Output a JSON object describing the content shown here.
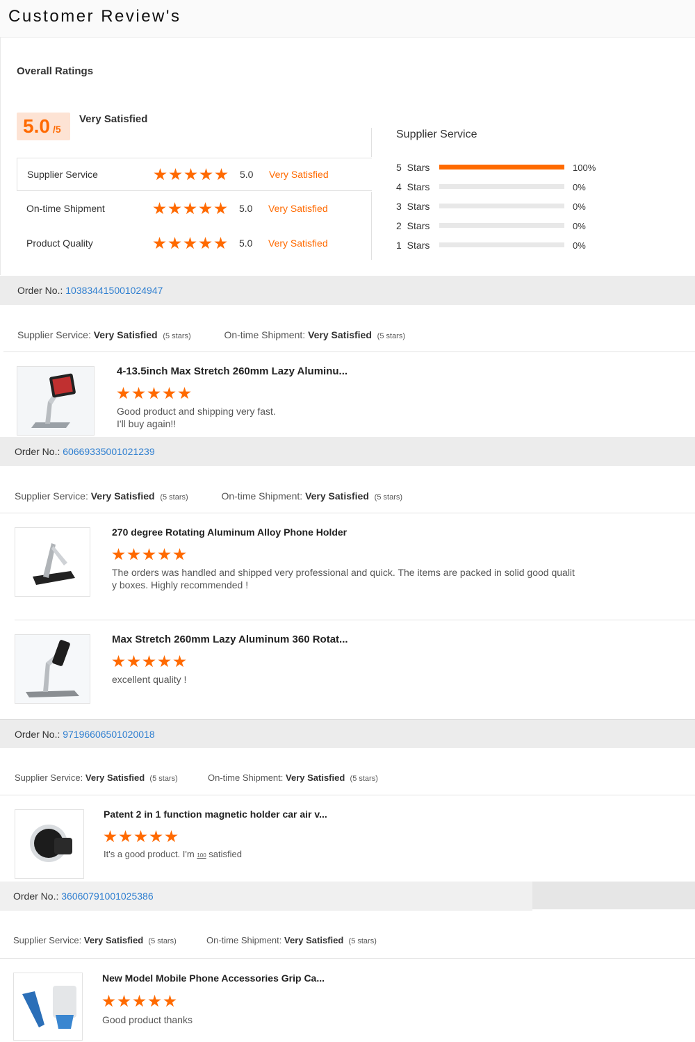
{
  "page": {
    "title": "Customer Review's"
  },
  "overall": {
    "heading": "Overall Ratings",
    "score": "5.0",
    "score_max": "/5",
    "score_text": "Very Satisfied",
    "ratings": [
      {
        "label": "Supplier Service",
        "stars": 5,
        "value": "5.0",
        "text": "Very Satisfied"
      },
      {
        "label": "On-time Shipment",
        "stars": 5,
        "value": "5.0",
        "text": "Very Satisfied"
      },
      {
        "label": "Product Quality",
        "stars": 5,
        "value": "5.0",
        "text": "Very Satisfied"
      }
    ]
  },
  "distribution": {
    "title": "Supplier Service",
    "rows": [
      {
        "label": "5 Stars",
        "fraction": 1.0,
        "pct": "100%"
      },
      {
        "label": "4 Stars",
        "fraction": 0,
        "pct": "0%"
      },
      {
        "label": "3 Stars",
        "fraction": 0,
        "pct": "0%"
      },
      {
        "label": "2 Stars",
        "fraction": 0,
        "pct": "0%"
      },
      {
        "label": "1 Stars",
        "fraction": 0,
        "pct": "0%"
      }
    ]
  },
  "labels": {
    "order_no": "Order No.:",
    "supplier_service": "Supplier Service:",
    "ontime_shipment": "On-time Shipment:",
    "very_satisfied": "Very Satisfied",
    "five_stars": "(5 stars)"
  },
  "orders": [
    {
      "number": "103834415001024947",
      "products": [
        {
          "title": "4-13.5inch Max Stretch 260mm Lazy Aluminu...",
          "stars": 5,
          "comment_lines": [
            "Good product and shipping very fast.",
            "I'll buy again!!"
          ]
        }
      ]
    },
    {
      "number": "60669335001021239",
      "products": [
        {
          "title": "270 degree Rotating Aluminum Alloy Phone Holder",
          "stars": 5,
          "comment_lines": [
            "The orders was handled and shipped very professional and quick. The items are packed in solid good qualit",
            "y boxes. Highly recommended !"
          ]
        },
        {
          "title": "Max Stretch 260mm Lazy Aluminum 360 Rotat...",
          "stars": 5,
          "comment_lines": [
            "excellent quality !"
          ]
        }
      ]
    },
    {
      "number": "97196606501020018",
      "products": [
        {
          "title": "Patent 2 in 1 function magnetic holder car air v...",
          "stars": 5,
          "comment_pre": "It's a good product. I'm ",
          "comment_mini": "100",
          "comment_post": " satisfied"
        }
      ]
    },
    {
      "number": "36060791001025386",
      "products": [
        {
          "title": "New Model Mobile Phone Accessories Grip Ca...",
          "stars": 5,
          "comment_lines": [
            "Good  product thanks"
          ]
        }
      ]
    }
  ]
}
